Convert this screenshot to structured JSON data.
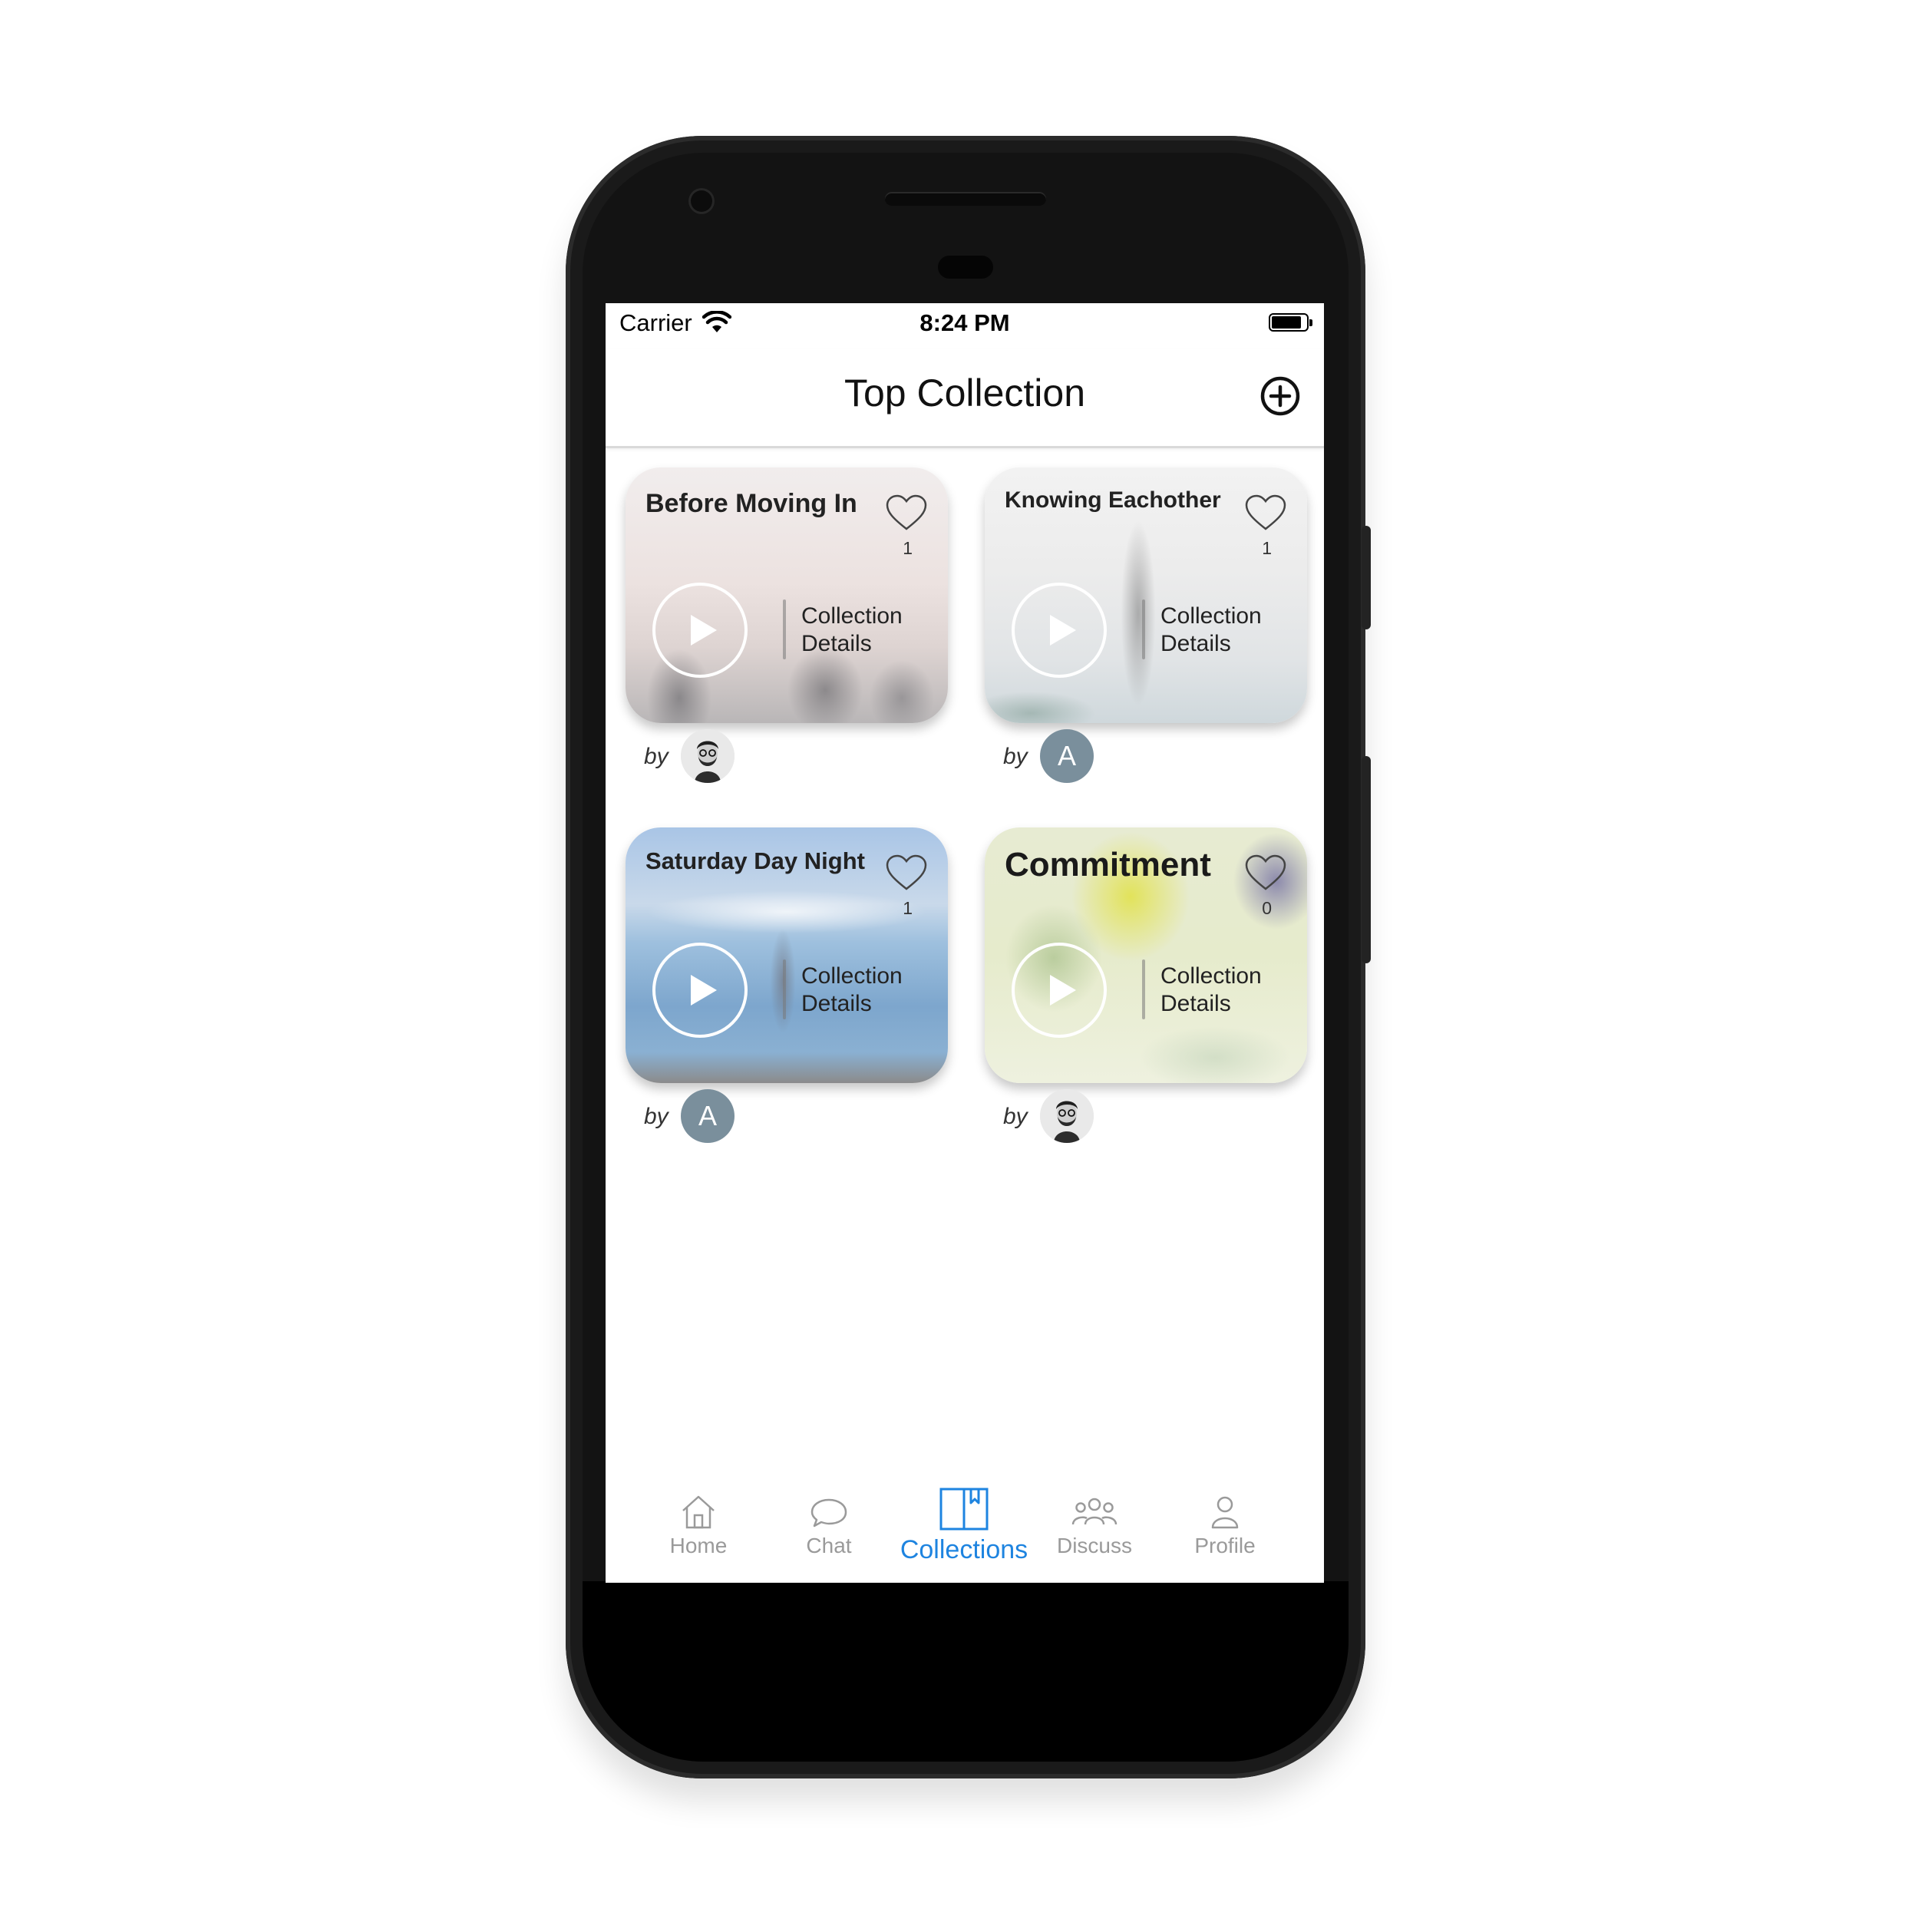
{
  "status_bar": {
    "carrier": "Carrier",
    "time": "8:24 PM"
  },
  "header": {
    "title": "Top Collection"
  },
  "collections": [
    {
      "title": "Before Moving In",
      "likes": "1",
      "details_line1": "Collection",
      "details_line2": "Details",
      "by": "by",
      "author_avatar": "photo"
    },
    {
      "title": "Knowing Eachother",
      "likes": "1",
      "details_line1": "Collection",
      "details_line2": "Details",
      "by": "by",
      "author_initial": "A"
    },
    {
      "title": "Saturday Day Night",
      "likes": "1",
      "details_line1": "Collection",
      "details_line2": "Details",
      "by": "by",
      "author_initial": "A"
    },
    {
      "title": "Commitment",
      "likes": "0",
      "details_line1": "Collection",
      "details_line2": "Details",
      "by": "by",
      "author_avatar": "photo"
    }
  ],
  "tabs": [
    {
      "label": "Home",
      "icon": "home-icon"
    },
    {
      "label": "Chat",
      "icon": "chat-icon"
    },
    {
      "label": "Collections",
      "icon": "book-icon",
      "active": true
    },
    {
      "label": "Discuss",
      "icon": "group-icon"
    },
    {
      "label": "Profile",
      "icon": "person-icon"
    }
  ],
  "colors": {
    "accent": "#1e84e0",
    "inactive_tab": "#9a9a9a",
    "avatar_bg": "#7a8f9c"
  }
}
